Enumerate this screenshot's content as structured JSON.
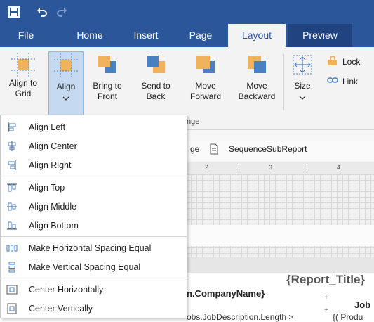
{
  "quick_access": {
    "save_icon": "save-icon",
    "undo_icon": "undo-icon",
    "redo_icon": "redo-icon"
  },
  "tabs": [
    {
      "label": "File"
    },
    {
      "label": "Home"
    },
    {
      "label": "Insert"
    },
    {
      "label": "Page"
    },
    {
      "label": "Layout"
    },
    {
      "label": "Preview"
    }
  ],
  "ribbon": {
    "align_to_grid": "Align to Grid",
    "align_line1": "Align",
    "bring_to_front_1": "Bring to",
    "bring_to_front_2": "Front",
    "send_to_back_1": "Send to",
    "send_to_back_2": "Back",
    "move_forward_1": "Move",
    "move_forward_2": "Forward",
    "move_backward_1": "Move",
    "move_backward_2": "Backward",
    "size": "Size",
    "lock": "Lock",
    "link": "Link",
    "group_label_fragment": "nge"
  },
  "document_tabs": {
    "partial": "ge",
    "sequence_subreport": "SequenceSubReport"
  },
  "ruler": {
    "ticks": [
      "2",
      "3",
      "4"
    ]
  },
  "canvas": {
    "report_title": "{Report_Title}",
    "company_name": "n.CompanyName}",
    "job_label": "Job",
    "bottom_text": "obs.JobDescription.Length > ",
    "bottom_text2": "{( Produ"
  },
  "align_menu": {
    "items": [
      {
        "label": "Align Left",
        "icon": "align-left-icon"
      },
      {
        "label": "Align Center",
        "icon": "align-center-icon"
      },
      {
        "label": "Align Right",
        "icon": "align-right-icon"
      },
      {
        "label": "Align Top",
        "icon": "align-top-icon"
      },
      {
        "label": "Align Middle",
        "icon": "align-middle-icon"
      },
      {
        "label": "Align Bottom",
        "icon": "align-bottom-icon"
      },
      {
        "label": "Make Horizontal Spacing Equal",
        "icon": "horizontal-spacing-icon"
      },
      {
        "label": "Make Vertical Spacing Equal",
        "icon": "vertical-spacing-icon"
      },
      {
        "label": "Center Horizontally",
        "icon": "center-horizontally-icon"
      },
      {
        "label": "Center Vertically",
        "icon": "center-vertically-icon"
      }
    ]
  },
  "colors": {
    "accent": "#2b579a",
    "icon_orange": "#f0b25a",
    "icon_blue": "#4a7fc1"
  }
}
